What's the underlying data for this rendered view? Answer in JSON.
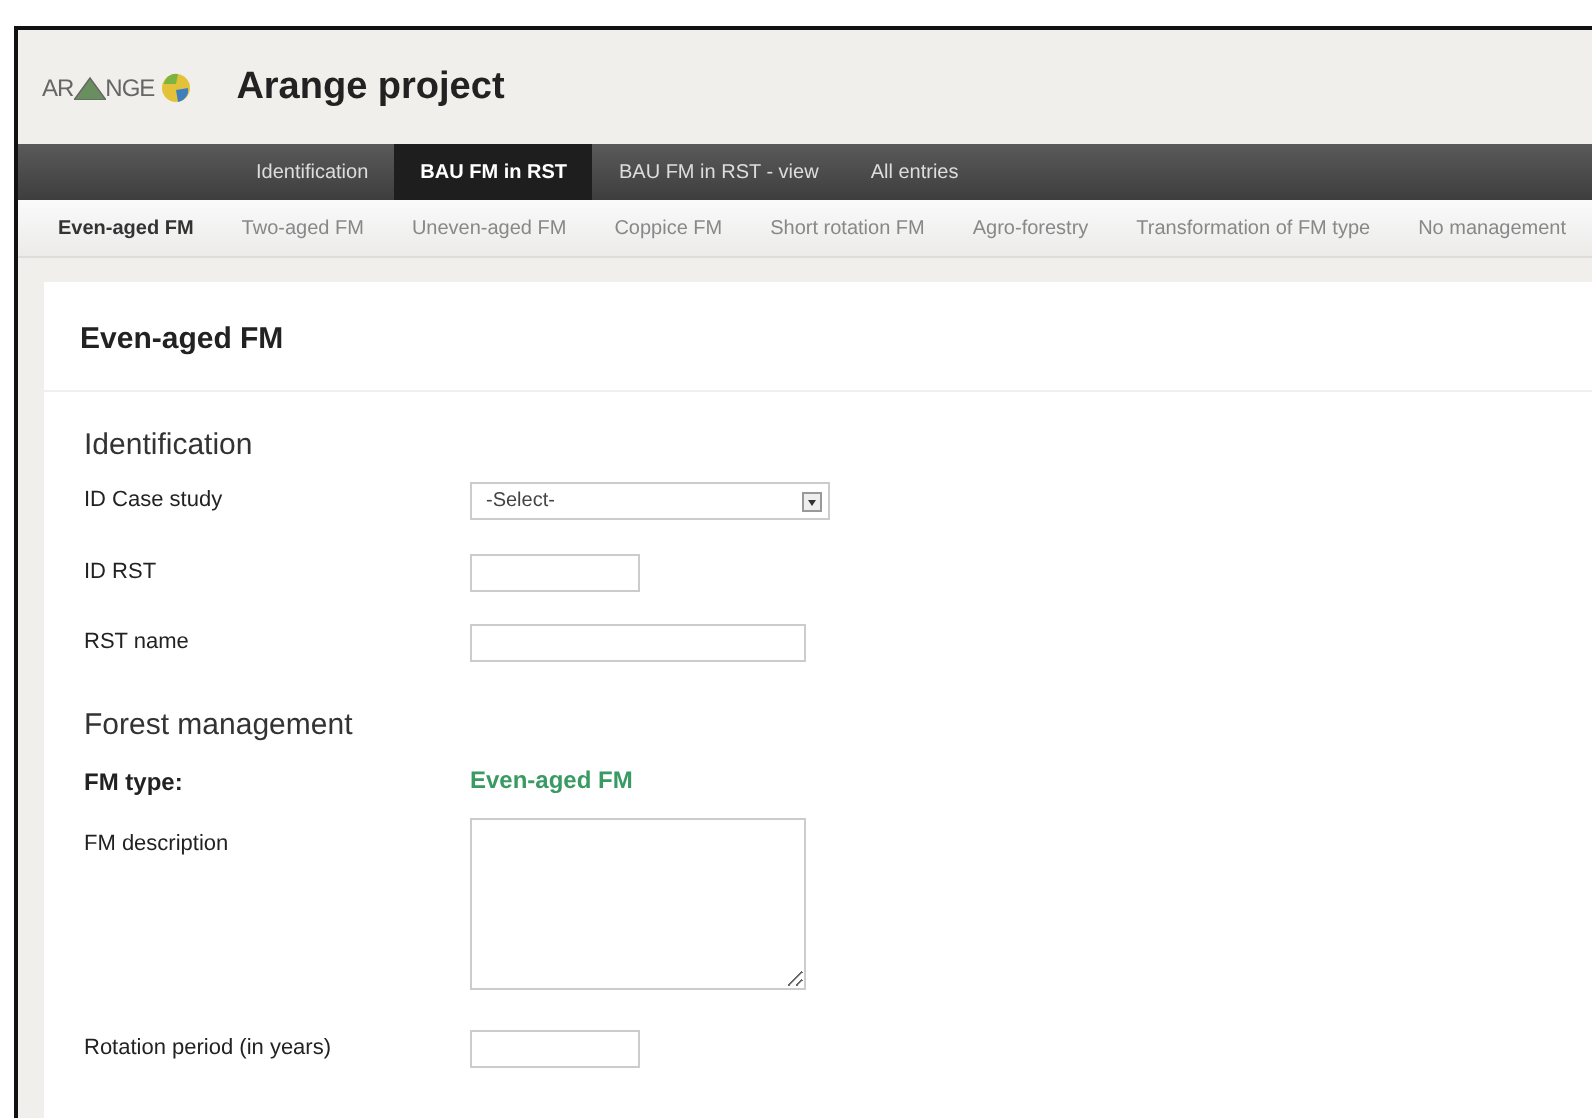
{
  "logo": {
    "left": "AR",
    "right": "NGE"
  },
  "header": {
    "title": "Arange project"
  },
  "main_nav": [
    {
      "label": "Identification",
      "selected": false
    },
    {
      "label": "BAU FM in RST",
      "selected": true
    },
    {
      "label": "BAU FM in RST - view",
      "selected": false
    },
    {
      "label": "All entries",
      "selected": false
    }
  ],
  "sub_nav": [
    {
      "label": "Even-aged FM",
      "selected": true
    },
    {
      "label": "Two-aged FM",
      "selected": false
    },
    {
      "label": "Uneven-aged FM",
      "selected": false
    },
    {
      "label": "Coppice FM",
      "selected": false
    },
    {
      "label": "Short rotation FM",
      "selected": false
    },
    {
      "label": "Agro-forestry",
      "selected": false
    },
    {
      "label": "Transformation of FM type",
      "selected": false
    },
    {
      "label": "No management",
      "selected": false
    }
  ],
  "card": {
    "title": "Even-aged FM",
    "sections": [
      {
        "heading": "Identification",
        "fields": [
          {
            "kind": "select",
            "label": "ID Case study",
            "value": "-Select-"
          },
          {
            "kind": "short",
            "label": "ID RST"
          },
          {
            "kind": "long",
            "label": "RST name"
          }
        ]
      },
      {
        "heading": "Forest management",
        "fields": [
          {
            "kind": "static",
            "label": "FM type:",
            "value": "Even-aged FM"
          },
          {
            "kind": "textarea",
            "label": "FM description"
          },
          {
            "kind": "short",
            "label": "Rotation period (in years)"
          }
        ]
      }
    ]
  }
}
